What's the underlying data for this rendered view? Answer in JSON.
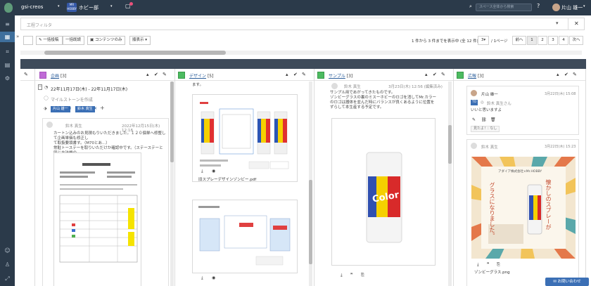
{
  "topbar": {
    "workspace": "gsi-creos",
    "space_badge": "MR\nHOBBY",
    "space": "ホビー部",
    "search_placeholder": "スペース全体から検索",
    "user": "片山 雄一"
  },
  "filter": {
    "placeholder": "工程フィルタ"
  },
  "toolbar": {
    "bulk_post": "一括投稿",
    "bulk_read": "一括既読",
    "contents_only": "コンテンツのみ",
    "order": "順表示"
  },
  "pager": {
    "summary_pre": "1 件から 3 件までを表示中 (全 12 件)",
    "per_page": "3",
    "per_page_unit": "/ 1ページ",
    "prev": "前へ",
    "pages": [
      "1",
      "2",
      "3",
      "4"
    ],
    "next": "次へ"
  },
  "columns": {
    "kikaku": {
      "title": "企画",
      "count": "[3]",
      "date_range": "22年11月17日(木) - 22年11月17日(木)",
      "milestone": "マイルストーンを作成",
      "tags": [
        "片山 雄一",
        "鈴木 真生"
      ],
      "post": {
        "author": "鈴木 真生",
        "time": "2022年12月15日(木) 12:18",
        "body1": "カートン込みのお見積もりいただきました。１２０個単へ修整して企画単価も修正し",
        "body2": "て取扱要領書す。（M70とあ...）",
        "body3": "常駐トーステーを取りいただけか確認中です。（ステーステーと同じ方法機の",
        "body4": "確認）"
      }
    },
    "design": {
      "title": "デザイン",
      "count": "[5]",
      "intro": "ます。",
      "file1": "旧スプレーデザインゾンビー.pdf"
    },
    "sample": {
      "title": "サンプル",
      "count": "[3]",
      "post": {
        "author": "鈴木 真生",
        "time": "3月23日(木) 12:56 (編集済み)",
        "body1": "サンプル用であがってきたものです。",
        "body2": "ゾンビーグラスの裏のミスーホビーのロゴを消してMr.カラー",
        "body3": "のロゴは器体を並んだ時にバランスが良くあるように位置を",
        "body4": "ずらして本生産する予定です。"
      }
    },
    "koukoku": {
      "title": "広報",
      "count": "[3]",
      "reply": {
        "author": "片山 雄一",
        "time": "3月22日(木) 15:08",
        "to_badge": "TO",
        "to_name": "鈴木 真生さん",
        "text": "いいと思いますよ",
        "seen": "見たよ！: なし"
      },
      "post": {
        "author": "鈴木 真生",
        "time": "3月22日(木) 15:23",
        "poster_company": "アダイア株式会社×Mr.HOBBY",
        "poster_line1": "懐かしのスプレーが",
        "poster_line2": "グラスになりました。",
        "file": "ゾンビーグラス.png"
      }
    }
  },
  "chat_button": "お問い合わせ",
  "colors": {
    "topbar": "#2b3a4a",
    "kikaku": "#c06bd6",
    "design": "#4cbb60",
    "sample": "#4cbb60",
    "koukoku": "#4cbb60",
    "accent": "#3b6fb5"
  }
}
